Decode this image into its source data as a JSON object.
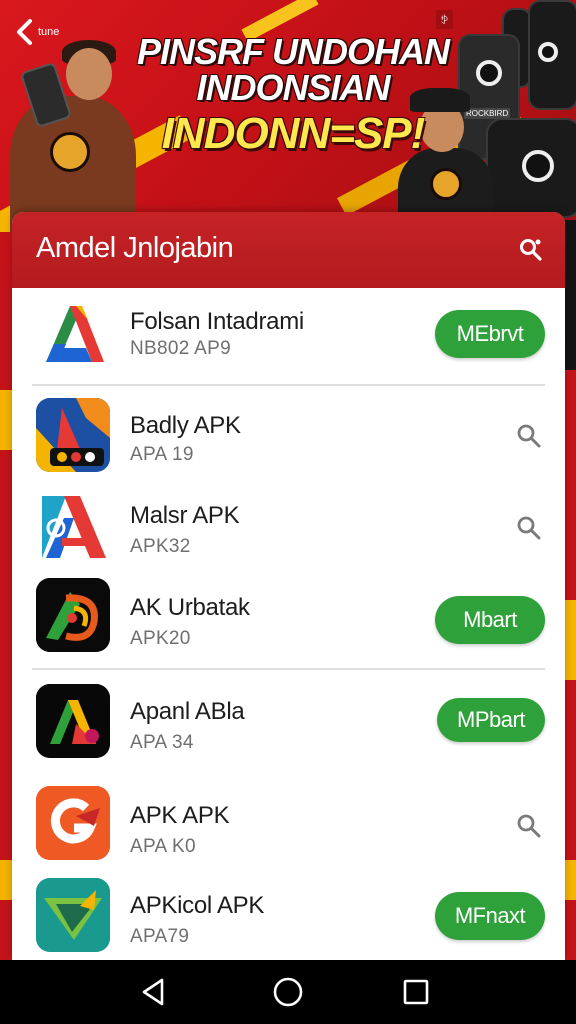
{
  "banner": {
    "back_label": "tune",
    "top_mark": "ꉣ",
    "headline_line1": "PINSRF UNDOHAN",
    "headline_line2": "INDONSIAN",
    "headline_line3": "INDONN=SP!",
    "device_label": "ROCKBIRD"
  },
  "header": {
    "title": "Amdel Jnlojabin",
    "search_icon": "search-share-icon"
  },
  "apps": [
    {
      "name": "Folsan Intadrami",
      "sub": "NB802 AP9",
      "action": "button",
      "button_label": "MEbrvt",
      "icon": "google-ads-like-icon"
    },
    {
      "name": "Badly APK",
      "sub": "APA 19",
      "action": "search",
      "icon": "multicolor-game-icon"
    },
    {
      "name": "Malsr APK",
      "sub": "APK32",
      "action": "search",
      "icon": "blue-red-a-icon"
    },
    {
      "name": "AK Urbatak",
      "sub": "APK20",
      "action": "button",
      "button_label": "Mbart",
      "icon": "dark-swirl-icon"
    },
    {
      "name": "Apanl ABla",
      "sub": "APA 34",
      "action": "button",
      "button_label": "MPbart",
      "icon": "gradient-a-icon"
    },
    {
      "name": "APK APK",
      "sub": "APA K0",
      "action": "search",
      "icon": "orange-g-icon"
    },
    {
      "name": "APKicol APK",
      "sub": "APA79",
      "action": "button",
      "button_label": "MFnaxt",
      "icon": "green-arrow-icon"
    }
  ],
  "colors": {
    "brand_red": "#c52326",
    "accent_green": "#2ea13a",
    "accent_yellow": "#f4b400"
  },
  "navbar": {
    "back_icon": "triangle-back-icon",
    "home_icon": "circle-home-icon",
    "recent_icon": "square-recents-icon"
  }
}
